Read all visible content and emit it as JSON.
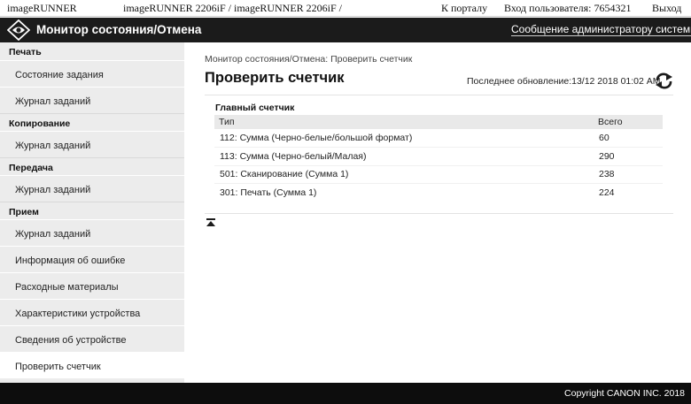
{
  "header": {
    "brand": "imageRUNNER",
    "model": "imageRUNNER 2206iF / imageRUNNER 2206iF /",
    "portal_link": "К порталу",
    "login_info": "Вход пользователя: 7654321",
    "logout": "Выход"
  },
  "titlebar": {
    "icon": "eye-diamond-icon",
    "title": "Монитор состояния/Отмена",
    "admin_message": "Сообщение администратору системы"
  },
  "sidebar": {
    "sections": [
      {
        "title": "Печать",
        "items": [
          "Состояние задания",
          "Журнал заданий"
        ]
      },
      {
        "title": "Копирование",
        "items": [
          "Журнал заданий"
        ]
      },
      {
        "title": "Передача",
        "items": [
          "Журнал заданий"
        ]
      },
      {
        "title": "Прием",
        "items": [
          "Журнал заданий"
        ]
      }
    ],
    "extra_items": [
      "Информация об ошибке",
      "Расходные материалы",
      "Характеристики устройства",
      "Сведения об устройстве",
      "Проверить счетчик"
    ],
    "active_item": "Проверить счетчик"
  },
  "main": {
    "breadcrumb": "Монитор состояния/Отмена: Проверить счетчик",
    "title": "Проверить счетчик",
    "last_update": "Последнее обновление:13/12 2018 01:02 AM",
    "refresh_icon": "refresh-icon",
    "table": {
      "caption": "Главный счетчик",
      "headers": [
        "Тип",
        "Всего"
      ],
      "rows": [
        [
          "112: Сумма (Черно-белые/большой формат)",
          "60"
        ],
        [
          "113: Сумма (Черно-белый/Малая)",
          "290"
        ],
        [
          "501: Сканирование (Сумма 1)",
          "238"
        ],
        [
          "301: Печать (Сумма 1)",
          "224"
        ]
      ]
    },
    "back_to_top_icon": "back-to-top-icon"
  },
  "footer": {
    "copyright": "Copyright CANON INC. 2018"
  },
  "colors": {
    "titlebar_bg": "#1b1b1b",
    "footer_bg": "#0d0d0d",
    "sidebar_bg": "#ececec",
    "table_header_bg": "#e9e9e9"
  }
}
